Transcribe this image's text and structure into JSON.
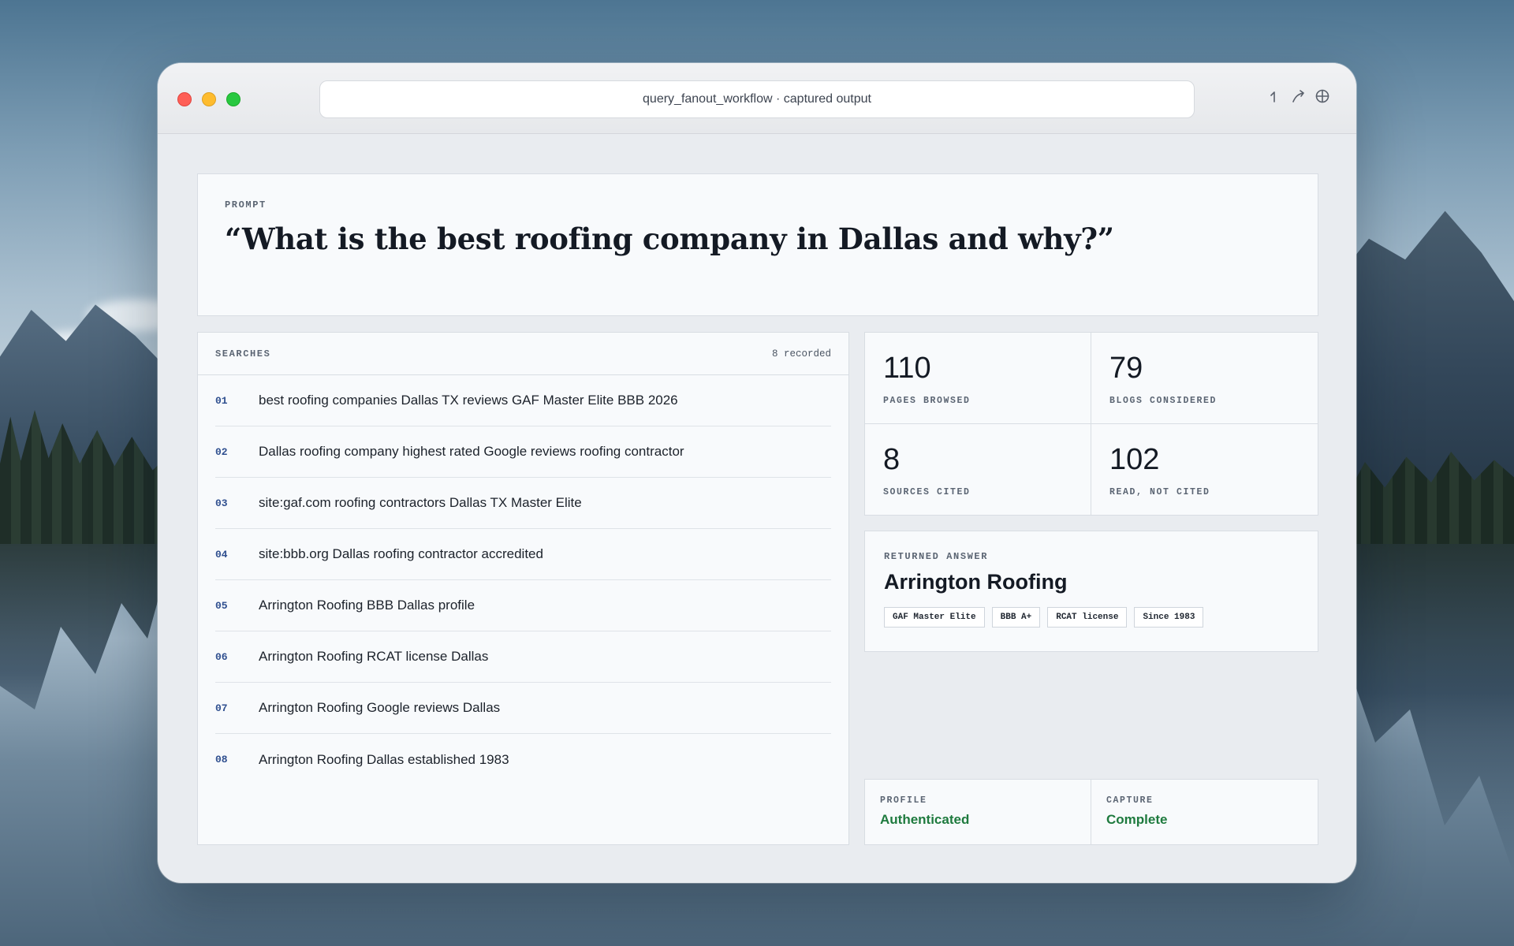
{
  "window": {
    "title": "query_fanout_workflow · captured output"
  },
  "prompt": {
    "label": "PROMPT",
    "text": "“What is the best roofing company in Dallas and why?”"
  },
  "searches": {
    "label": "SEARCHES",
    "count_text": "8 recorded",
    "items": [
      {
        "num": "01",
        "text": "best roofing companies Dallas TX reviews GAF Master Elite BBB 2026"
      },
      {
        "num": "02",
        "text": "Dallas roofing company highest rated Google reviews roofing contractor"
      },
      {
        "num": "03",
        "text": "site:gaf.com roofing contractors Dallas TX Master Elite"
      },
      {
        "num": "04",
        "text": "site:bbb.org Dallas roofing contractor accredited"
      },
      {
        "num": "05",
        "text": "Arrington Roofing BBB Dallas profile"
      },
      {
        "num": "06",
        "text": "Arrington Roofing RCAT license Dallas"
      },
      {
        "num": "07",
        "text": "Arrington Roofing Google reviews Dallas"
      },
      {
        "num": "08",
        "text": "Arrington Roofing Dallas established 1983"
      }
    ]
  },
  "stats": [
    {
      "value": "110",
      "label": "PAGES BROWSED"
    },
    {
      "value": "79",
      "label": "BLOGS CONSIDERED"
    },
    {
      "value": "8",
      "label": "SOURCES CITED"
    },
    {
      "value": "102",
      "label": "READ, NOT CITED"
    }
  ],
  "answer": {
    "label": "RETURNED ANSWER",
    "name": "Arrington Roofing",
    "tags": [
      "GAF Master Elite",
      "BBB A+",
      "RCAT license",
      "Since 1983"
    ]
  },
  "status": {
    "profile": {
      "label": "PROFILE",
      "value": "Authenticated"
    },
    "capture": {
      "label": "CAPTURE",
      "value": "Complete"
    }
  },
  "colors": {
    "accent_number": "#2f4f8f",
    "status_ok": "#1e7a3e",
    "traffic_red": "#fe5f57",
    "traffic_yellow": "#febc2e",
    "traffic_green": "#28c840"
  },
  "icons": [
    "back-arrow-icon",
    "share-arrow-icon",
    "globe-icon"
  ]
}
